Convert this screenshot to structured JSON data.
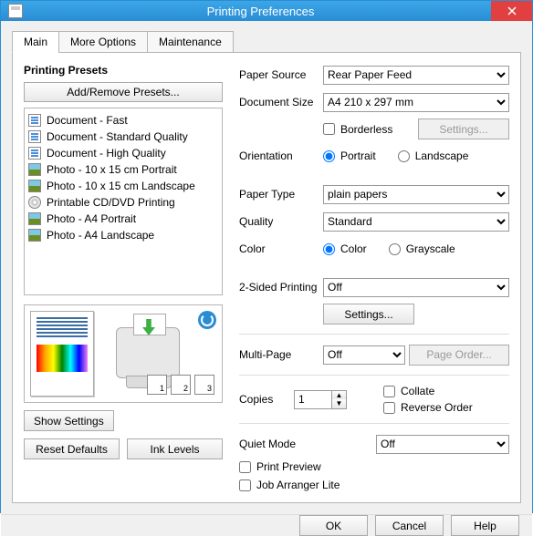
{
  "window": {
    "title": "Printing Preferences"
  },
  "tabs": {
    "main": "Main",
    "more": "More Options",
    "maint": "Maintenance"
  },
  "presets": {
    "title": "Printing Presets",
    "addremove": "Add/Remove Presets...",
    "items": [
      "Document - Fast",
      "Document - Standard Quality",
      "Document - High Quality",
      "Photo - 10 x 15 cm Portrait",
      "Photo - 10 x 15 cm Landscape",
      "Printable CD/DVD Printing",
      "Photo - A4 Portrait",
      "Photo - A4 Landscape"
    ]
  },
  "buttons": {
    "showSettings": "Show Settings",
    "resetDefaults": "Reset Defaults",
    "inkLevels": "Ink Levels",
    "ok": "OK",
    "cancel": "Cancel",
    "help": "Help",
    "settings": "Settings...",
    "pageOrder": "Page Order..."
  },
  "labels": {
    "paperSource": "Paper Source",
    "documentSize": "Document Size",
    "borderless": "Borderless",
    "orientation": "Orientation",
    "portrait": "Portrait",
    "landscape": "Landscape",
    "paperType": "Paper Type",
    "quality": "Quality",
    "color": "Color",
    "colorOpt": "Color",
    "grayscale": "Grayscale",
    "twoSided": "2-Sided Printing",
    "multiPage": "Multi-Page",
    "copies": "Copies",
    "collate": "Collate",
    "reverse": "Reverse Order",
    "quietMode": "Quiet Mode",
    "printPreview": "Print Preview",
    "jobArranger": "Job Arranger Lite"
  },
  "values": {
    "paperSource": "Rear Paper Feed",
    "documentSize": "A4 210 x 297 mm",
    "paperType": "plain papers",
    "quality": "Standard",
    "twoSided": "Off",
    "multiPage": "Off",
    "copies": "1",
    "quietMode": "Off"
  }
}
